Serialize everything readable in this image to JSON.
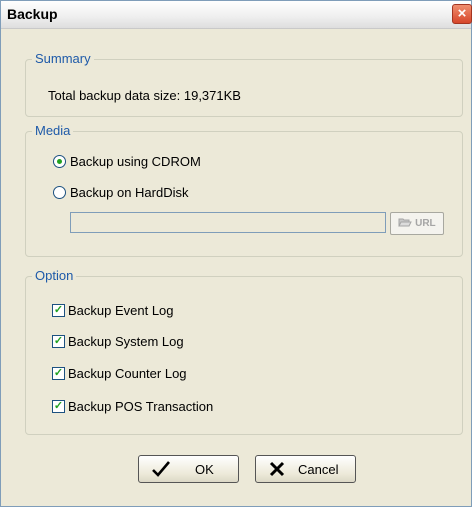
{
  "window": {
    "title": "Backup",
    "close_glyph": "×"
  },
  "summary": {
    "legend": "Summary",
    "text": "Total backup data size: 19,371KB"
  },
  "media": {
    "legend": "Media",
    "options": [
      {
        "label": "Backup using CDROM",
        "selected": true
      },
      {
        "label": "Backup on HardDisk",
        "selected": false
      }
    ],
    "path_value": "",
    "url_button_label": "URL",
    "url_button_icon": "folder-open-icon"
  },
  "option": {
    "legend": "Option",
    "items": [
      {
        "label": "Backup Event Log",
        "checked": true
      },
      {
        "label": "Backup System Log",
        "checked": true
      },
      {
        "label": "Backup Counter Log",
        "checked": true
      },
      {
        "label": "Backup POS Transaction",
        "checked": true
      }
    ]
  },
  "buttons": {
    "ok_label": "OK",
    "ok_icon": "checkmark-icon",
    "cancel_label": "Cancel",
    "cancel_icon": "x-icon"
  },
  "colors": {
    "dialog_bg": "#ece9d8",
    "legend_text": "#1e5aa9",
    "check_green": "#21a121",
    "close_red": "#d6462a"
  }
}
